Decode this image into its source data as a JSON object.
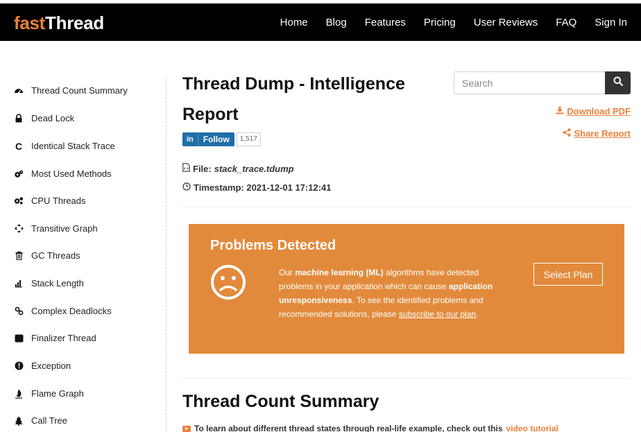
{
  "header": {
    "logo_part1": "fast",
    "logo_part2": "Thread",
    "nav": [
      "Home",
      "Blog",
      "Features",
      "Pricing",
      "User Reviews",
      "FAQ",
      "Sign In"
    ]
  },
  "sidebar": {
    "items": [
      {
        "label": "Thread Count Summary",
        "icon": "tachometer-icon"
      },
      {
        "label": "Dead Lock",
        "icon": "lock-icon"
      },
      {
        "label": "Identical Stack Trace",
        "icon": "c-letter-icon"
      },
      {
        "label": "Most Used Methods",
        "icon": "cogs-icon"
      },
      {
        "label": "CPU Threads",
        "icon": "gears-icon"
      },
      {
        "label": "Transitive Graph",
        "icon": "crosshair-icon"
      },
      {
        "label": "GC Threads",
        "icon": "trash-icon"
      },
      {
        "label": "Stack Length",
        "icon": "bar-steps-icon"
      },
      {
        "label": "Complex Deadlocks",
        "icon": "chain-link-icon"
      },
      {
        "label": "Finalizer Thread",
        "icon": "square-icon"
      },
      {
        "label": "Exception",
        "icon": "exclamation-circle-icon"
      },
      {
        "label": "Flame Graph",
        "icon": "flame-icon"
      },
      {
        "label": "Call Tree",
        "icon": "tree-icon"
      }
    ]
  },
  "main": {
    "title": "Thread Dump - Intelligence Report",
    "search_placeholder": "Search",
    "download_label": "Download PDF",
    "share_label": "Share Report",
    "linkedin": {
      "in": "in",
      "follow": "Follow",
      "count": "1,517"
    },
    "file_label": "File:",
    "file_name": "stack_trace.tdump",
    "timestamp": "Timestamp: 2021-12-01 17:12:41",
    "section_title": "Thread Count Summary",
    "learn_text": "To learn about different thread states through real-life example, check out this",
    "learn_link": "video tutorial"
  },
  "problems": {
    "title": "Problems Detected",
    "text_1": "Our ",
    "text_2": "machine learning (ML)",
    "text_3": " algorithms have detected problems in your application which can cause ",
    "text_4": "application unresponsiveness",
    "text_5": ". To see the identified problems and recommended solutions, please ",
    "text_6": "subscribe to our plan",
    "text_7": ".",
    "button": "Select Plan"
  },
  "colors": {
    "accent": "#e8823a",
    "panel": "#e28a3b",
    "nav_bg": "#000000",
    "linkedin": "#1f6ea8"
  }
}
